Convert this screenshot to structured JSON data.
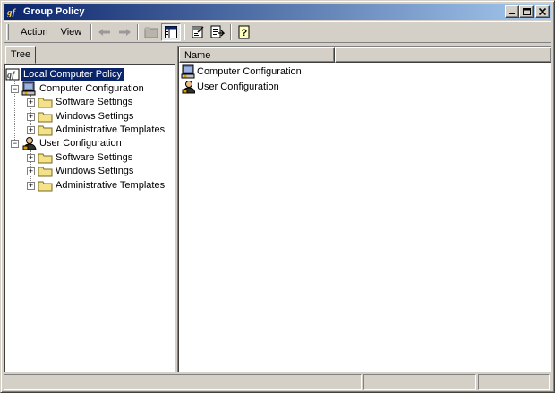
{
  "window": {
    "title": "Group Policy"
  },
  "menu": {
    "action": "Action",
    "view": "View"
  },
  "tree": {
    "tab_label": "Tree",
    "root": "Local Computer Policy",
    "computer": {
      "label": "Computer Configuration",
      "children": [
        "Software Settings",
        "Windows Settings",
        "Administrative Templates"
      ]
    },
    "user": {
      "label": "User Configuration",
      "children": [
        "Software Settings",
        "Windows Settings",
        "Administrative Templates"
      ]
    }
  },
  "list": {
    "columns": [
      "Name"
    ],
    "items": [
      "Computer Configuration",
      "User Configuration"
    ]
  },
  "icons": {
    "title": "policy-icon",
    "back": "back-arrow-icon",
    "forward": "forward-arrow-icon",
    "up": "up-folder-icon",
    "show_tree": "show-tree-icon",
    "properties": "properties-icon",
    "export": "export-list-icon",
    "help": "help-icon",
    "folder": "folder-icon",
    "computer": "computer-icon",
    "user": "user-icon"
  },
  "colors": {
    "titlebar_start": "#0a246a",
    "titlebar_end": "#a6caf0",
    "selection": "#0a246a",
    "folder": "#f4e28a"
  }
}
